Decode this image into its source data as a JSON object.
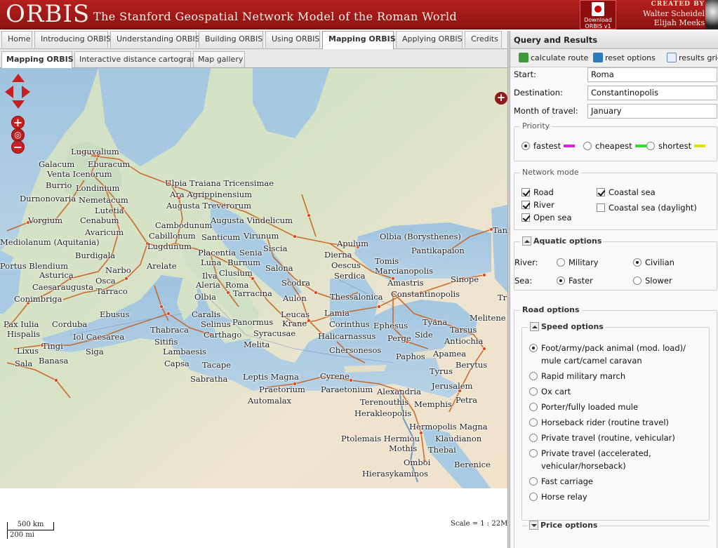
{
  "header": {
    "logo": "ORBIS",
    "tagline": "The Stanford Geospatial Network Model of the Roman World",
    "download_line1": "Download",
    "download_line2": "ORBIS v1",
    "created_by": "CREATED BY",
    "author1": "Walter Scheidel",
    "author2": "Elijah Meeks"
  },
  "main_tabs": [
    "Home",
    "Introducing ORBIS",
    "Understanding ORBIS",
    "Building ORBIS",
    "Using ORBIS",
    "Mapping ORBIS",
    "Applying ORBIS",
    "Credits"
  ],
  "sub_tabs": [
    "Mapping ORBIS",
    "Interactive distance cartogram",
    "Map gallery"
  ],
  "map": {
    "places": [
      "Luguvalium",
      "Galacum",
      "Eburacum",
      "Venta Icenorum",
      "Burrio",
      "Londinium",
      "Durnonovaria",
      "Nemetacum",
      "Lutetia",
      "Vorgium",
      "Cenabum",
      "Avaricum",
      "Mediolanum (Aquitania)",
      "Burdigala",
      "Portus Blendium",
      "Asturica",
      "Caesaraugusta",
      "Conimbriga",
      "Pax Iulia",
      "Hispalis",
      "Lixus",
      "Sala",
      "Banasa",
      "Tingi",
      "Corduba",
      "Siga",
      "Iol Caesarea",
      "Sitifis",
      "Lambaesis",
      "Capsa",
      "Tacape",
      "Sabratha",
      "Thabraca",
      "Carthago",
      "Narbo",
      "Osca",
      "Tarraco",
      "Ebusus",
      "Arelate",
      "Lugdunum",
      "Cabillonum",
      "Cambodunum",
      "Augusta Treverorum",
      "Ara Agrippinensium",
      "Ulpia Traiana Tricensimae",
      "Augusta Vindelicum",
      "Santicum",
      "Virunum",
      "Siscia",
      "Placentia",
      "Senia",
      "Luna",
      "Burnum",
      "Clusium",
      "Salona",
      "Ilva",
      "Aleria",
      "Roma",
      "Olbia",
      "Tarracina",
      "Caralis",
      "Selinus",
      "Panormus",
      "Syracusae",
      "Melita",
      "Scodra",
      "Aulon",
      "Leucas",
      "Krane",
      "Thessalonica",
      "Lamia",
      "Corinthus",
      "Apulum",
      "Dierna",
      "Oescus",
      "Serdica",
      "Tomis",
      "Marcianopolis",
      "Amastris",
      "Olbia (Borysthenes)",
      "Pantikapaion",
      "Sinope",
      "Constantinopolis",
      "Ephesus",
      "Halicarnassus",
      "Perge",
      "Side",
      "Tyana",
      "Melitene",
      "Tarsus",
      "Antiochia",
      "Chersonesos",
      "Paphos",
      "Apamea",
      "Berytus",
      "Tyrus",
      "Jerusalem",
      "Petra",
      "Leptis Magna",
      "Praetorium",
      "Automalax",
      "Cyrene",
      "Paraetonium",
      "Alexandria",
      "Terenouthis",
      "Memphis",
      "Herakleopolis",
      "Hermopolis Magna",
      "Ptolemais Hermiou",
      "Klaudianon",
      "Mothis",
      "Thebai",
      "Omboi",
      "Berenice",
      "Hierasykaminos",
      "Tan",
      "Tr"
    ],
    "scale_km": "500 km",
    "scale_mi": "200 mi",
    "scale": "Scale = 1 : 22M"
  },
  "panel": {
    "title": "Query and Results",
    "toolbar": {
      "calc": "calculate route",
      "reset": "reset options",
      "grid": "results grid"
    },
    "start_label": "Start:",
    "start_value": "Roma",
    "dest_label": "Destination:",
    "dest_value": "Constantinopolis",
    "month_label": "Month of travel:",
    "month_value": "January",
    "priority": {
      "legend": "Priority",
      "fastest": "fastest",
      "cheapest": "cheapest",
      "shortest": "shortest",
      "fastest_color": "#e020e0",
      "cheapest_color": "#30e030",
      "shortest_color": "#e8e000"
    },
    "network": {
      "legend": "Network mode",
      "road": "Road",
      "river": "River",
      "open_sea": "Open sea",
      "coastal_sea": "Coastal sea",
      "coastal_daylight": "Coastal sea (daylight)"
    },
    "aquatic": {
      "legend": "Aquatic options",
      "river_label": "River:",
      "military": "Military",
      "civilian": "Civilian",
      "sea_label": "Sea:",
      "faster": "Faster",
      "slower": "Slower"
    },
    "road": {
      "legend": "Road options",
      "speed_legend": "Speed options",
      "options": [
        [
          "Foot/army/pack animal (mod. load)/",
          "mule cart/camel caravan"
        ],
        [
          "Rapid military march"
        ],
        [
          "Ox cart"
        ],
        [
          "Porter/fully loaded mule"
        ],
        [
          "Horseback rider (routine travel)"
        ],
        [
          "Private travel (routine, vehicular)"
        ],
        [
          "Private travel (accelerated,",
          "vehicular/horseback)"
        ],
        [
          "Fast carriage"
        ],
        [
          "Horse relay"
        ]
      ],
      "price_legend": "Price options"
    }
  }
}
